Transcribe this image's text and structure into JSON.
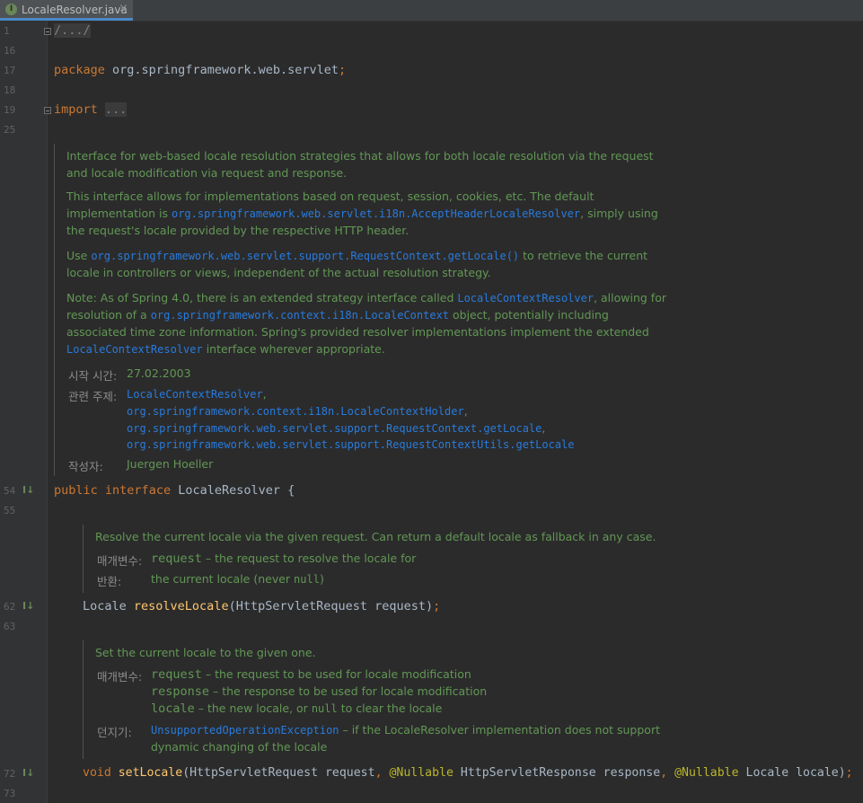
{
  "tab": {
    "icon_letter": "I",
    "filename": "LocaleResolver.java",
    "close": "×"
  },
  "gutter": {
    "line_numbers": [
      "1",
      "16",
      "17",
      "18",
      "19",
      "25",
      "54",
      "55",
      "62",
      "63",
      "72",
      "73"
    ],
    "impl_marker": "I↓"
  },
  "code": {
    "l1": "/.../",
    "l17_kw": "package",
    "l17_pkg": " org.springframework.web.servlet",
    "l17_semi": ";",
    "l19_kw": "import",
    "l19_rest": "...",
    "l54_kw1": "public",
    "l54_kw2": "interface",
    "l54_name": " LocaleResolver {",
    "l62_type": "Locale ",
    "l62_fn": "resolveLocale",
    "l62_args": "(HttpServletRequest request)",
    "l62_semi": ";",
    "l72_kw": "void",
    "l72_fn": "setLocale",
    "l72_a1": "(HttpServletRequest request",
    "l72_c1": ",",
    "l72_an1": "@Nullable",
    "l72_a2": " HttpServletResponse response",
    "l72_c2": ",",
    "l72_an2": "@Nullable",
    "l72_a3": " Locale locale)",
    "l72_semi": ";"
  },
  "doc1": {
    "p1a": "Interface for web-based locale resolution strategies that allows for both locale resolution via the request",
    "p1b": "and locale modification via request and response.",
    "p2a": "This interface allows for implementations based on request, session, cookies, etc. The default",
    "p2b_pre": "implementation is ",
    "p2b_code": "org.springframework.web.servlet.i18n.AcceptHeaderLocaleResolver",
    "p2b_post": ", simply using",
    "p2c": "the request's locale provided by the respective HTTP header.",
    "p3a_pre": "Use ",
    "p3a_code": "org.springframework.web.servlet.support.RequestContext.getLocale()",
    "p3a_post": " to retrieve the current",
    "p3b": "locale in controllers or views, independent of the actual resolution strategy.",
    "p4a_pre": "Note: As of Spring 4.0, there is an extended strategy interface called ",
    "p4a_code": "LocaleContextResolver",
    "p4a_post": ", allowing for",
    "p4b_pre": "resolution of a ",
    "p4b_code": "org.springframework.context.i18n.LocaleContext",
    "p4b_post": " object, potentially including",
    "p4c": "associated time zone information. Spring's provided resolver implementations implement the extended",
    "p4d_code": "LocaleContextResolver",
    "p4d_post": " interface wherever appropriate.",
    "since_label": "시작 시간:",
    "since_value": "27.02.2003",
    "see_label": "관련 주제:",
    "see1": "LocaleContextResolver",
    "see2": "org.springframework.context.i18n.LocaleContextHolder",
    "see3": "org.springframework.web.servlet.support.RequestContext.getLocale",
    "see4": "org.springframework.web.servlet.support.RequestContextUtils.getLocale",
    "comma": ",",
    "author_label": "작성자:",
    "author_value": "Juergen Hoeller"
  },
  "doc2": {
    "desc": "Resolve the current locale via the given request. Can return a default locale as fallback in any case.",
    "param_label": "매개변수:",
    "param_name": "request",
    "param_desc": " – the request to resolve the locale for",
    "return_label": "반환:",
    "return_pre": "the current locale (never ",
    "return_code": "null",
    "return_post": ")"
  },
  "doc3": {
    "desc": "Set the current locale to the given one.",
    "param_label": "매개변수:",
    "p1_name": "request",
    "p1_desc": " – the request to be used for locale modification",
    "p2_name": "response",
    "p2_desc": " – the response to be used for locale modification",
    "p3_name": "locale",
    "p3_desc_pre": " – the new locale, or ",
    "p3_code": "null",
    "p3_desc_post": " to clear the locale",
    "throws_label": "던지기:",
    "throws_code": "UnsupportedOperationException",
    "throws_desc": " – if the LocaleResolver implementation does not support",
    "throws_desc2": "dynamic changing of the locale"
  },
  "colors": {
    "background": "#2b2b2b",
    "keyword": "#cc7832",
    "method": "#ffc66d",
    "annotation": "#bbb529",
    "doc_text": "#629755",
    "doc_link": "#287bde"
  }
}
